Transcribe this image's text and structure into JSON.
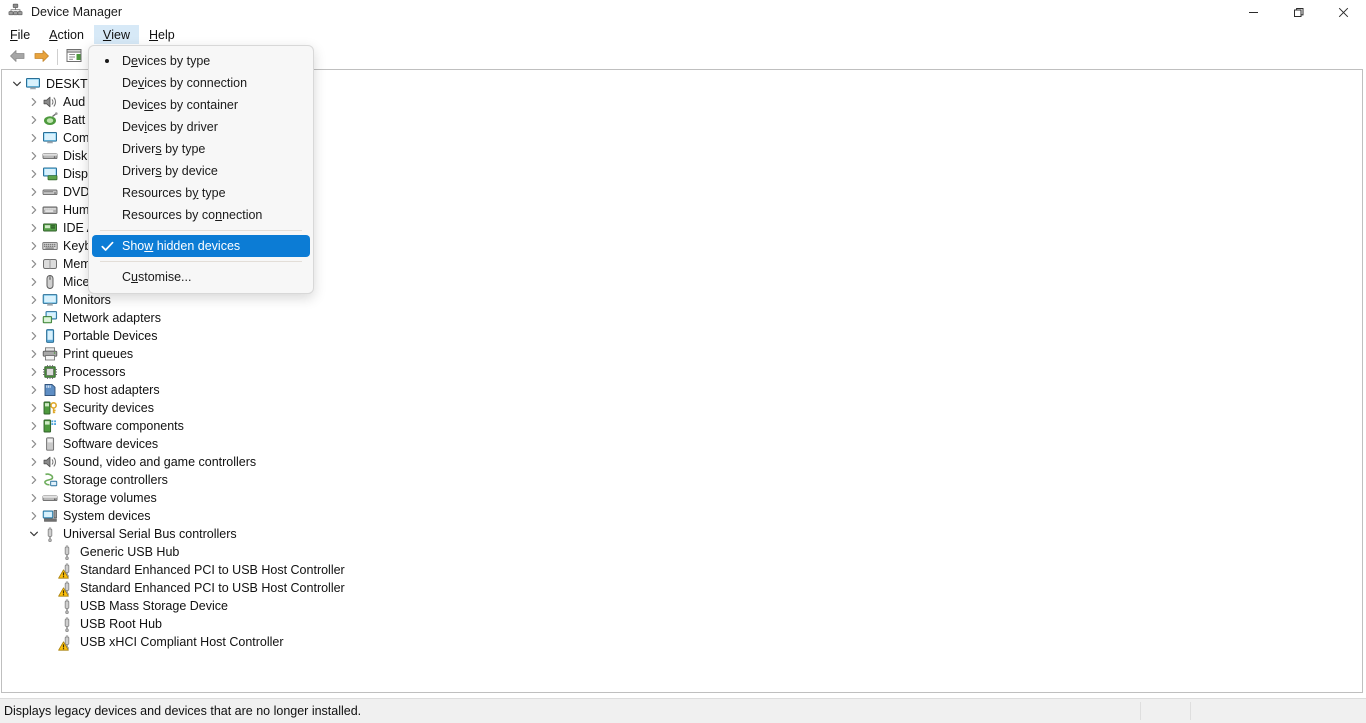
{
  "window": {
    "title": "Device Manager",
    "icon": "device-manager-icon",
    "controls": [
      {
        "name": "minimize-button",
        "glyph": "minimize"
      },
      {
        "name": "restore-button",
        "glyph": "restore"
      },
      {
        "name": "close-button",
        "glyph": "close"
      }
    ]
  },
  "menubar": {
    "items": [
      {
        "label": "File",
        "accel": "F",
        "active": false
      },
      {
        "label": "Action",
        "accel": "A",
        "active": false
      },
      {
        "label": "View",
        "accel": "V",
        "active": true
      },
      {
        "label": "Help",
        "accel": "H",
        "active": false
      }
    ]
  },
  "toolbar": {
    "buttons": [
      {
        "name": "back-button",
        "icon": "back-arrow-icon"
      },
      {
        "name": "forward-button",
        "icon": "forward-arrow-icon"
      },
      {
        "name": "properties-button",
        "icon": "properties-icon"
      }
    ]
  },
  "view_menu": {
    "items": [
      {
        "label": "Devices by type",
        "accel": "e",
        "mark": "radio",
        "selected": false,
        "separator_before": false
      },
      {
        "label": "Devices by connection",
        "accel": "v",
        "mark": "none",
        "selected": false,
        "separator_before": false
      },
      {
        "label": "Devices by container",
        "accel": "ic",
        "mark": "none",
        "selected": false,
        "separator_before": false
      },
      {
        "label": "Devices by driver",
        "accel": "i",
        "mark": "none",
        "selected": false,
        "separator_before": false
      },
      {
        "label": "Drivers by type",
        "accel": "s",
        "mark": "none",
        "selected": false,
        "separator_before": false
      },
      {
        "label": "Drivers by device",
        "accel": "s",
        "mark": "none",
        "selected": false,
        "separator_before": false
      },
      {
        "label": "Resources by type",
        "accel": "y",
        "mark": "none",
        "selected": false,
        "separator_before": false
      },
      {
        "label": "Resources by connection",
        "accel": "n",
        "mark": "none",
        "selected": false,
        "separator_before": false
      },
      {
        "label": "Show hidden devices",
        "accel": "w",
        "mark": "check",
        "selected": true,
        "separator_before": true
      },
      {
        "label": "Customise...",
        "accel": "u",
        "mark": "none",
        "selected": false,
        "separator_before": true
      }
    ]
  },
  "tree": {
    "root": {
      "label": "DESKTO",
      "icon": "computer-icon",
      "expanded": true,
      "depth": 0,
      "warning": false
    },
    "items": [
      {
        "label": "DESKTO",
        "icon": "computer-icon",
        "state": "expanded",
        "depth": 0,
        "warning": false
      },
      {
        "label": "Aud",
        "icon": "audio-icon",
        "state": "collapsed",
        "depth": 1,
        "warning": false
      },
      {
        "label": "Batt",
        "icon": "battery-icon",
        "state": "collapsed",
        "depth": 1,
        "warning": false
      },
      {
        "label": "Com",
        "icon": "computer-icon",
        "state": "collapsed",
        "depth": 1,
        "warning": false
      },
      {
        "label": "Disk",
        "icon": "disk-drive-icon",
        "state": "collapsed",
        "depth": 1,
        "warning": false
      },
      {
        "label": "Disp",
        "icon": "display-adapter-icon",
        "state": "collapsed",
        "depth": 1,
        "warning": false
      },
      {
        "label": "DVD",
        "icon": "dvd-drive-icon",
        "state": "collapsed",
        "depth": 1,
        "warning": false
      },
      {
        "label": "Hum",
        "icon": "hid-icon",
        "state": "collapsed",
        "depth": 1,
        "warning": false
      },
      {
        "label": "IDE A",
        "icon": "ide-controller-icon",
        "state": "collapsed",
        "depth": 1,
        "warning": false
      },
      {
        "label": "Keyb",
        "icon": "keyboard-icon",
        "state": "collapsed",
        "depth": 1,
        "warning": false
      },
      {
        "label": "Mem",
        "icon": "memory-icon",
        "state": "collapsed",
        "depth": 1,
        "warning": false
      },
      {
        "label": "Mice",
        "icon": "mouse-icon",
        "state": "collapsed",
        "depth": 1,
        "warning": false
      },
      {
        "label": "Monitors",
        "icon": "monitor-icon",
        "state": "collapsed",
        "depth": 1,
        "warning": false
      },
      {
        "label": "Network adapters",
        "icon": "network-adapter-icon",
        "state": "collapsed",
        "depth": 1,
        "warning": false
      },
      {
        "label": "Portable Devices",
        "icon": "portable-device-icon",
        "state": "collapsed",
        "depth": 1,
        "warning": false
      },
      {
        "label": "Print queues",
        "icon": "printer-icon",
        "state": "collapsed",
        "depth": 1,
        "warning": false
      },
      {
        "label": "Processors",
        "icon": "processor-icon",
        "state": "collapsed",
        "depth": 1,
        "warning": false
      },
      {
        "label": "SD host adapters",
        "icon": "sd-host-adapter-icon",
        "state": "collapsed",
        "depth": 1,
        "warning": false
      },
      {
        "label": "Security devices",
        "icon": "security-device-icon",
        "state": "collapsed",
        "depth": 1,
        "warning": false
      },
      {
        "label": "Software components",
        "icon": "software-component-icon",
        "state": "collapsed",
        "depth": 1,
        "warning": false
      },
      {
        "label": "Software devices",
        "icon": "software-device-icon",
        "state": "collapsed",
        "depth": 1,
        "warning": false
      },
      {
        "label": "Sound, video and game controllers",
        "icon": "audio-icon",
        "state": "collapsed",
        "depth": 1,
        "warning": false
      },
      {
        "label": "Storage controllers",
        "icon": "storage-controller-icon",
        "state": "collapsed",
        "depth": 1,
        "warning": false
      },
      {
        "label": "Storage volumes",
        "icon": "storage-volume-icon",
        "state": "collapsed",
        "depth": 1,
        "warning": false
      },
      {
        "label": "System devices",
        "icon": "system-device-icon",
        "state": "collapsed",
        "depth": 1,
        "warning": false
      },
      {
        "label": "Universal Serial Bus controllers",
        "icon": "usb-icon",
        "state": "expanded",
        "depth": 1,
        "warning": false
      },
      {
        "label": "Generic USB Hub",
        "icon": "usb-icon",
        "state": "leaf",
        "depth": 2,
        "warning": false
      },
      {
        "label": "Standard Enhanced PCI to USB Host Controller",
        "icon": "usb-icon",
        "state": "leaf",
        "depth": 2,
        "warning": true
      },
      {
        "label": "Standard Enhanced PCI to USB Host Controller",
        "icon": "usb-icon",
        "state": "leaf",
        "depth": 2,
        "warning": true
      },
      {
        "label": "USB Mass Storage Device",
        "icon": "usb-icon",
        "state": "leaf",
        "depth": 2,
        "warning": false
      },
      {
        "label": "USB Root Hub",
        "icon": "usb-icon",
        "state": "leaf",
        "depth": 2,
        "warning": false
      },
      {
        "label": "USB xHCI Compliant Host Controller",
        "icon": "usb-icon",
        "state": "leaf",
        "depth": 2,
        "warning": true
      }
    ]
  },
  "statusbar": {
    "text": "Displays legacy devices and devices that are no longer installed."
  },
  "colors": {
    "menu_highlight": "#0c7cd5",
    "menubar_active": "#d7e9f7",
    "warning_yellow": "#ffc20e",
    "statusbar_bg": "#f0f0f0",
    "menu_bg": "#f7f7f7"
  }
}
